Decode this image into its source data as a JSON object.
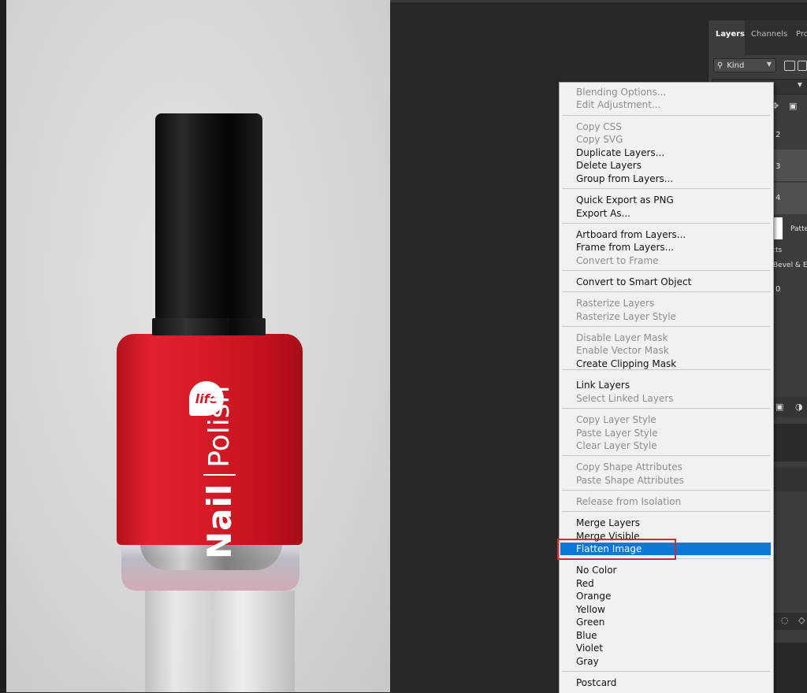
{
  "canvas": {
    "product": {
      "logo_text": "life",
      "brand_primary": "Nail",
      "brand_secondary": "Polish"
    }
  },
  "layers_panel": {
    "tabs": [
      {
        "label": "Layers",
        "active": true
      },
      {
        "label": "Channels",
        "active": false
      },
      {
        "label": "Pro",
        "active": false
      }
    ],
    "filter": {
      "label": "Kind",
      "icon": "search-icon"
    },
    "layer_numbers": [
      "2",
      "3",
      "4",
      "0"
    ],
    "partial_text": {
      "pattern": "Patte",
      "effects": "cts",
      "bevel": "Bevel & E"
    }
  },
  "context_menu": {
    "items": [
      {
        "label": "Blending Options...",
        "state": "disabled"
      },
      {
        "label": "Edit Adjustment...",
        "state": "disabled"
      },
      {
        "label": "Copy CSS",
        "state": "disabled"
      },
      {
        "label": "Copy SVG",
        "state": "disabled"
      },
      {
        "label": "Duplicate Layers...",
        "state": "enabled"
      },
      {
        "label": "Delete Layers",
        "state": "enabled"
      },
      {
        "label": "Group from Layers...",
        "state": "enabled"
      },
      {
        "label": "Quick Export as PNG",
        "state": "enabled"
      },
      {
        "label": "Export As...",
        "state": "enabled"
      },
      {
        "label": "Artboard from Layers...",
        "state": "enabled"
      },
      {
        "label": "Frame from Layers...",
        "state": "enabled"
      },
      {
        "label": "Convert to Frame",
        "state": "disabled"
      },
      {
        "label": "Convert to Smart Object",
        "state": "enabled"
      },
      {
        "label": "Rasterize Layers",
        "state": "disabled"
      },
      {
        "label": "Rasterize Layer Style",
        "state": "disabled"
      },
      {
        "label": "Disable Layer Mask",
        "state": "disabled"
      },
      {
        "label": "Enable Vector Mask",
        "state": "disabled"
      },
      {
        "label": "Create Clipping Mask",
        "state": "enabled"
      },
      {
        "label": "Link Layers",
        "state": "enabled"
      },
      {
        "label": "Select Linked Layers",
        "state": "disabled"
      },
      {
        "label": "Copy Layer Style",
        "state": "disabled"
      },
      {
        "label": "Paste Layer Style",
        "state": "disabled"
      },
      {
        "label": "Clear Layer Style",
        "state": "disabled"
      },
      {
        "label": "Copy Shape Attributes",
        "state": "disabled"
      },
      {
        "label": "Paste Shape Attributes",
        "state": "disabled"
      },
      {
        "label": "Release from Isolation",
        "state": "disabled"
      },
      {
        "label": "Merge Layers",
        "state": "enabled"
      },
      {
        "label": "Merge Visible",
        "state": "enabled"
      },
      {
        "label": "Flatten Image",
        "state": "selected"
      },
      {
        "label": "No Color",
        "state": "enabled"
      },
      {
        "label": "Red",
        "state": "enabled"
      },
      {
        "label": "Orange",
        "state": "enabled"
      },
      {
        "label": "Yellow",
        "state": "enabled"
      },
      {
        "label": "Green",
        "state": "enabled"
      },
      {
        "label": "Blue",
        "state": "enabled"
      },
      {
        "label": "Violet",
        "state": "enabled"
      },
      {
        "label": "Gray",
        "state": "enabled"
      },
      {
        "label": "Postcard",
        "state": "enabled"
      }
    ]
  },
  "colors": {
    "selection": "#0a78d4",
    "highlight_annotation": "#e0252d",
    "bottle_red": "#d51a27",
    "app_background": "#282828"
  }
}
